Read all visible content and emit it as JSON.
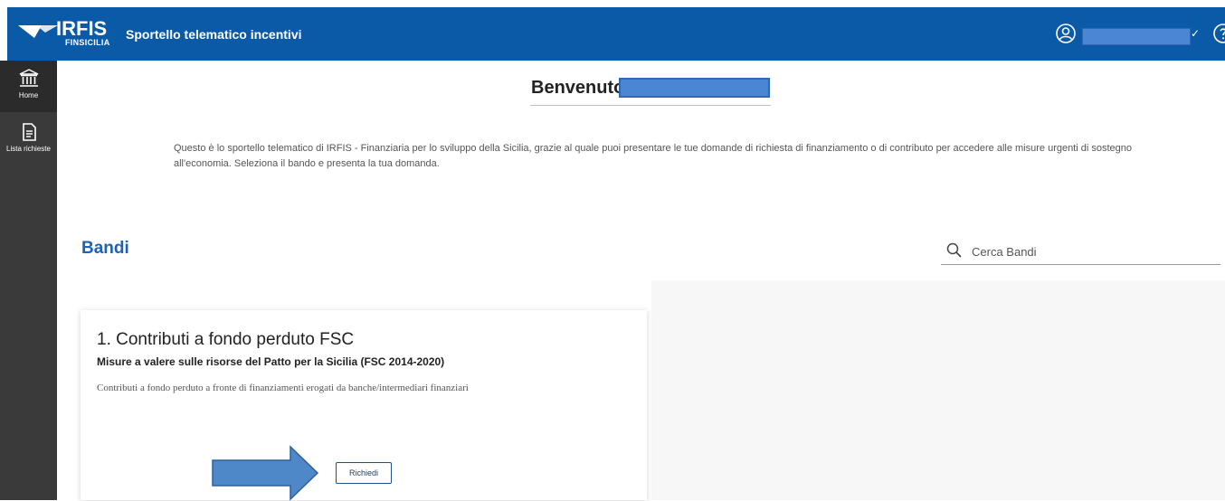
{
  "header": {
    "logo_text": "IRFIS",
    "logo_subtext": "FINSICILIA",
    "app_title": "Sportello telematico incentivi",
    "user_chevron": "✓"
  },
  "sidebar": {
    "items": [
      {
        "label": "Home",
        "icon": "bank-icon"
      },
      {
        "label": "Lista richieste",
        "icon": "document-icon"
      }
    ]
  },
  "main": {
    "welcome": "Benvenuto",
    "intro": "Questo è lo sportello telematico di IRFIS - Finanziaria per lo sviluppo della Sicilia, grazie al quale puoi presentare le tue domande di richiesta di finanziamento o di contributo per accedere alle misure urgenti di sostegno all'economia. Seleziona il bando e presenta la tua domanda.",
    "section_title": "Bandi",
    "search": {
      "placeholder": "Cerca Bandi",
      "value": ""
    }
  },
  "bandi": [
    {
      "title": "1. Contributi a fondo perduto FSC",
      "subtitle": "Misure a valere sulle risorse del Patto per la Sicilia (FSC 2014-2020)",
      "description": "Contributi a fondo perduto a fronte di finanziamenti erogati da banche/intermediari finanziari",
      "button_label": "Richiedi"
    }
  ],
  "colors": {
    "header_bg": "#0a5aa8",
    "sidebar_bg": "#3a3a3a",
    "accent": "#1a63b8",
    "redaction": "#4a86d4"
  }
}
